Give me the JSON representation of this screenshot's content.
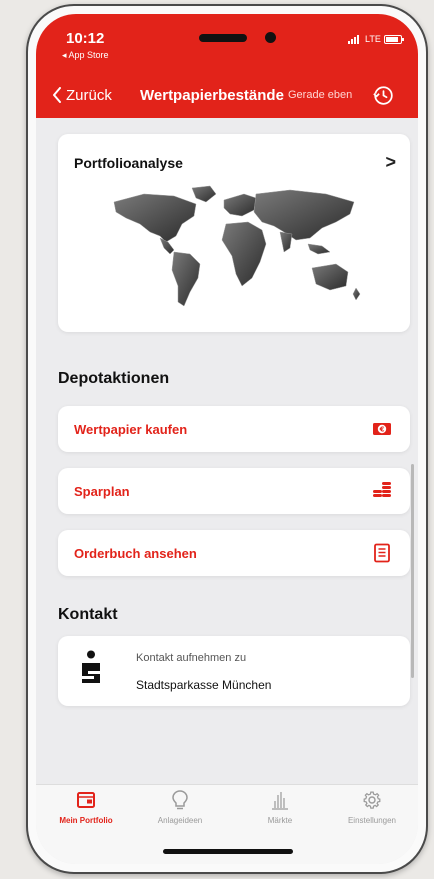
{
  "status_bar": {
    "time": "10:12",
    "back_app": "◂ App Store",
    "network": "LTE"
  },
  "nav": {
    "back_label": "Zurück",
    "title": "Wertpapierbestände",
    "updated": "Gerade eben"
  },
  "portfolio": {
    "title": "Portfolioanalyse",
    "chevron": ">"
  },
  "depot": {
    "title": "Depotaktionen",
    "actions": [
      {
        "label": "Wertpapier kaufen",
        "icon": "euro-banknote-icon"
      },
      {
        "label": "Sparplan",
        "icon": "coin-stack-icon"
      },
      {
        "label": "Orderbuch ansehen",
        "icon": "orderbook-icon"
      }
    ]
  },
  "contact": {
    "title": "Kontakt",
    "line1": "Kontakt aufnehmen zu",
    "line2": "Stadtsparkasse München"
  },
  "tabs": [
    {
      "label": "Mein Portfolio",
      "icon": "portfolio-wallet-icon",
      "active": true
    },
    {
      "label": "Anlageideen",
      "icon": "lightbulb-icon",
      "active": false
    },
    {
      "label": "Märkte",
      "icon": "bar-chart-icon",
      "active": false
    },
    {
      "label": "Einstellungen",
      "icon": "gear-icon",
      "active": false
    }
  ],
  "colors": {
    "brand": "#e2231a",
    "background": "#ececee",
    "card": "#ffffff"
  }
}
